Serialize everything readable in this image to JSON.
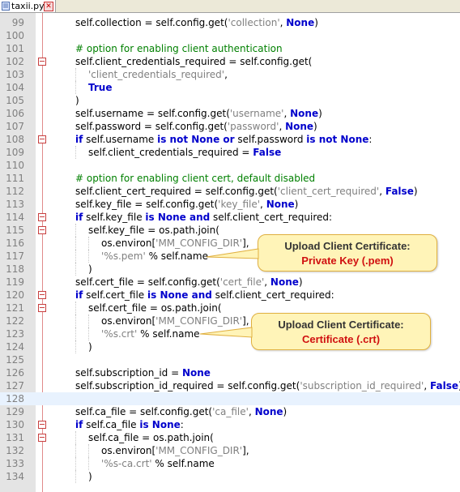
{
  "tab": {
    "filename": "taxii.py",
    "close_glyph": "✕"
  },
  "colors": {
    "keyword": "#0000cc",
    "string": "#808080",
    "comment": "#008000",
    "callout_highlight": "#d01010"
  },
  "lines": [
    {
      "n": "99",
      "indent": 0,
      "fold": false,
      "current": false,
      "segs": [
        [
          "self.collection = self.config.get(",
          ""
        ],
        [
          "'collection'",
          "str"
        ],
        [
          ", ",
          ""
        ],
        [
          "None",
          "kw"
        ],
        [
          ")",
          ""
        ]
      ]
    },
    {
      "n": "100",
      "indent": 0,
      "fold": false,
      "current": false,
      "segs": []
    },
    {
      "n": "101",
      "indent": 0,
      "fold": false,
      "current": false,
      "segs": [
        [
          "# option for enabling client authentication",
          "cmt"
        ]
      ]
    },
    {
      "n": "102",
      "indent": 0,
      "fold": true,
      "current": false,
      "segs": [
        [
          "self.client_credentials_required = self.config.get(",
          ""
        ]
      ]
    },
    {
      "n": "103",
      "indent": 1,
      "fold": false,
      "current": false,
      "segs": [
        [
          "'client_credentials_required'",
          "str"
        ],
        [
          ",",
          ""
        ]
      ]
    },
    {
      "n": "104",
      "indent": 1,
      "fold": false,
      "current": false,
      "segs": [
        [
          "True",
          "kw"
        ]
      ]
    },
    {
      "n": "105",
      "indent": 0,
      "fold": false,
      "current": false,
      "segs": [
        [
          ")",
          ""
        ]
      ]
    },
    {
      "n": "106",
      "indent": 0,
      "fold": false,
      "current": false,
      "segs": [
        [
          "self.username = self.config.get(",
          ""
        ],
        [
          "'username'",
          "str"
        ],
        [
          ", ",
          ""
        ],
        [
          "None",
          "kw"
        ],
        [
          ")",
          ""
        ]
      ]
    },
    {
      "n": "107",
      "indent": 0,
      "fold": false,
      "current": false,
      "segs": [
        [
          "self.password = self.config.get(",
          ""
        ],
        [
          "'password'",
          "str"
        ],
        [
          ", ",
          ""
        ],
        [
          "None",
          "kw"
        ],
        [
          ")",
          ""
        ]
      ]
    },
    {
      "n": "108",
      "indent": 0,
      "fold": true,
      "current": false,
      "segs": [
        [
          "if",
          "kw"
        ],
        [
          " self.username ",
          ""
        ],
        [
          "is not None or",
          "kw"
        ],
        [
          " self.password ",
          ""
        ],
        [
          "is not None",
          "kw"
        ],
        [
          ":",
          ""
        ]
      ]
    },
    {
      "n": "109",
      "indent": 1,
      "fold": false,
      "current": false,
      "segs": [
        [
          "self.client_credentials_required = ",
          ""
        ],
        [
          "False",
          "kw"
        ]
      ]
    },
    {
      "n": "110",
      "indent": 0,
      "fold": false,
      "current": false,
      "segs": []
    },
    {
      "n": "111",
      "indent": 0,
      "fold": false,
      "current": false,
      "segs": [
        [
          "# option for enabling client cert, default disabled",
          "cmt"
        ]
      ]
    },
    {
      "n": "112",
      "indent": 0,
      "fold": false,
      "current": false,
      "segs": [
        [
          "self.client_cert_required = self.config.get(",
          ""
        ],
        [
          "'client_cert_required'",
          "str"
        ],
        [
          ", ",
          ""
        ],
        [
          "False",
          "kw"
        ],
        [
          ")",
          ""
        ]
      ]
    },
    {
      "n": "113",
      "indent": 0,
      "fold": false,
      "current": false,
      "segs": [
        [
          "self.key_file = self.config.get(",
          ""
        ],
        [
          "'key_file'",
          "str"
        ],
        [
          ", ",
          ""
        ],
        [
          "None",
          "kw"
        ],
        [
          ")",
          ""
        ]
      ]
    },
    {
      "n": "114",
      "indent": 0,
      "fold": true,
      "current": false,
      "segs": [
        [
          "if",
          "kw"
        ],
        [
          " self.key_file ",
          ""
        ],
        [
          "is None and",
          "kw"
        ],
        [
          " self.client_cert_required:",
          ""
        ]
      ]
    },
    {
      "n": "115",
      "indent": 1,
      "fold": true,
      "current": false,
      "segs": [
        [
          "self.key_file = os.path.join(",
          ""
        ]
      ]
    },
    {
      "n": "116",
      "indent": 2,
      "fold": false,
      "current": false,
      "segs": [
        [
          "os.environ[",
          ""
        ],
        [
          "'MM_CONFIG_DIR'",
          "str"
        ],
        [
          "],",
          ""
        ]
      ]
    },
    {
      "n": "117",
      "indent": 2,
      "fold": false,
      "current": false,
      "segs": [
        [
          "'%s.pem'",
          "str"
        ],
        [
          " % ",
          ""
        ],
        [
          "self.name",
          ""
        ]
      ]
    },
    {
      "n": "118",
      "indent": 1,
      "fold": false,
      "current": false,
      "segs": [
        [
          ")",
          ""
        ]
      ]
    },
    {
      "n": "119",
      "indent": 0,
      "fold": false,
      "current": false,
      "segs": [
        [
          "self.cert_file = self.config.get(",
          ""
        ],
        [
          "'cert_file'",
          "str"
        ],
        [
          ", ",
          ""
        ],
        [
          "None",
          "kw"
        ],
        [
          ")",
          ""
        ]
      ]
    },
    {
      "n": "120",
      "indent": 0,
      "fold": true,
      "current": false,
      "segs": [
        [
          "if",
          "kw"
        ],
        [
          " self.cert_file ",
          ""
        ],
        [
          "is None and",
          "kw"
        ],
        [
          " self.client_cert_required:",
          ""
        ]
      ]
    },
    {
      "n": "121",
      "indent": 1,
      "fold": true,
      "current": false,
      "segs": [
        [
          "self.cert_file = os.path.join(",
          ""
        ]
      ]
    },
    {
      "n": "122",
      "indent": 2,
      "fold": false,
      "current": false,
      "segs": [
        [
          "os.environ[",
          ""
        ],
        [
          "'MM_CONFIG_DIR'",
          "str"
        ],
        [
          "],",
          ""
        ]
      ]
    },
    {
      "n": "123",
      "indent": 2,
      "fold": false,
      "current": false,
      "segs": [
        [
          "'%s.crt'",
          "str"
        ],
        [
          " % ",
          ""
        ],
        [
          "self.name",
          ""
        ]
      ]
    },
    {
      "n": "124",
      "indent": 1,
      "fold": false,
      "current": false,
      "segs": [
        [
          ")",
          ""
        ]
      ]
    },
    {
      "n": "125",
      "indent": 0,
      "fold": false,
      "current": false,
      "segs": []
    },
    {
      "n": "126",
      "indent": 0,
      "fold": false,
      "current": false,
      "segs": [
        [
          "self.subscription_id = ",
          ""
        ],
        [
          "None",
          "kw"
        ]
      ]
    },
    {
      "n": "127",
      "indent": 0,
      "fold": false,
      "current": false,
      "segs": [
        [
          "self.subscription_id_required = self.config.get(",
          ""
        ],
        [
          "'subscription_id_required'",
          "str"
        ],
        [
          ", ",
          ""
        ],
        [
          "False",
          "kw"
        ],
        [
          ")",
          ""
        ]
      ]
    },
    {
      "n": "128",
      "indent": 0,
      "fold": false,
      "current": true,
      "segs": []
    },
    {
      "n": "129",
      "indent": 0,
      "fold": false,
      "current": false,
      "segs": [
        [
          "self.ca_file = self.config.get(",
          ""
        ],
        [
          "'ca_file'",
          "str"
        ],
        [
          ", ",
          ""
        ],
        [
          "None",
          "kw"
        ],
        [
          ")",
          ""
        ]
      ]
    },
    {
      "n": "130",
      "indent": 0,
      "fold": true,
      "current": false,
      "segs": [
        [
          "if",
          "kw"
        ],
        [
          " self.ca_file ",
          ""
        ],
        [
          "is None",
          "kw"
        ],
        [
          ":",
          ""
        ]
      ]
    },
    {
      "n": "131",
      "indent": 1,
      "fold": true,
      "current": false,
      "segs": [
        [
          "self.ca_file = os.path.join(",
          ""
        ]
      ]
    },
    {
      "n": "132",
      "indent": 2,
      "fold": false,
      "current": false,
      "segs": [
        [
          "os.environ[",
          ""
        ],
        [
          "'MM_CONFIG_DIR'",
          "str"
        ],
        [
          "],",
          ""
        ]
      ]
    },
    {
      "n": "133",
      "indent": 2,
      "fold": false,
      "current": false,
      "segs": [
        [
          "'%s-ca.crt'",
          "str"
        ],
        [
          " % ",
          ""
        ],
        [
          "self.name",
          ""
        ]
      ]
    },
    {
      "n": "134",
      "indent": 1,
      "fold": false,
      "current": false,
      "segs": [
        [
          ")",
          ""
        ]
      ]
    }
  ],
  "callouts": {
    "key": {
      "title": "Upload Client Certificate:",
      "highlight": "Private Key (.pem)"
    },
    "cert": {
      "title": "Upload Client Certificate:",
      "highlight": "Certificate (.crt)"
    }
  }
}
